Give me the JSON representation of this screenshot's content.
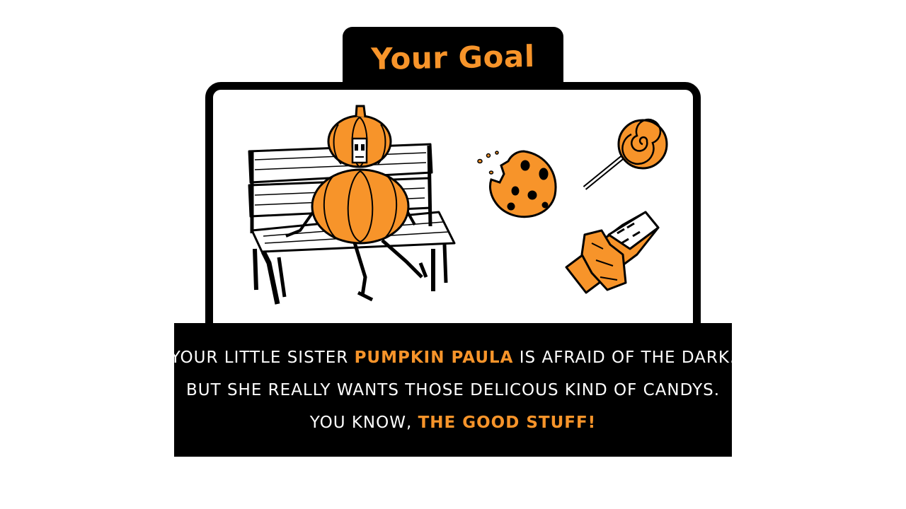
{
  "title": "Your Goal",
  "colors": {
    "accent": "#f7942a",
    "ink": "#000000",
    "paper": "#ffffff"
  },
  "illustration": {
    "characters": [
      "pumpkin-on-bench"
    ],
    "items": [
      "cookie",
      "lollipop",
      "candy-bar"
    ]
  },
  "caption": {
    "line1_a": "Your little sister ",
    "line1_highlight": "Pumpkin Paula",
    "line1_b": " is afraid of the dark.",
    "line2": "But she really wants those delicous kind of candys.",
    "line3_a": "You know, ",
    "line3_highlight": "the good stuff!"
  }
}
